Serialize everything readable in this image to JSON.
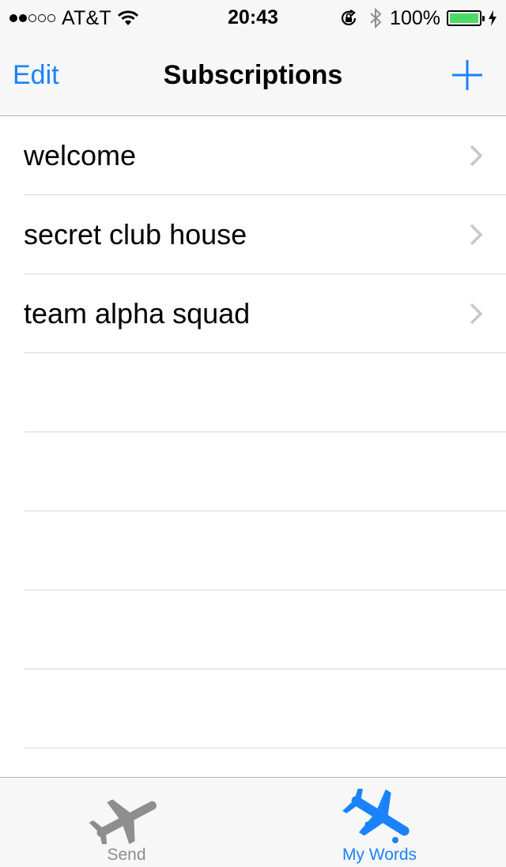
{
  "status_bar": {
    "carrier": "AT&T",
    "signal_bars_filled": 2,
    "signal_bars_total": 5,
    "time": "20:43",
    "battery_percent": "100%",
    "battery_color": "#4cd964",
    "icons": [
      "wifi-icon",
      "orientation-lock-icon",
      "bluetooth-icon",
      "battery-icon",
      "charging-bolt-icon"
    ]
  },
  "navbar": {
    "edit_label": "Edit",
    "title": "Subscriptions",
    "add_icon": "plus-icon"
  },
  "subscriptions": [
    {
      "label": "welcome"
    },
    {
      "label": "secret club house"
    },
    {
      "label": "team alpha squad"
    }
  ],
  "empty_rows": 5,
  "tabbar": {
    "tabs": [
      {
        "label": "Send",
        "icon": "airplane-takeoff-icon",
        "selected": false
      },
      {
        "label": "My Words",
        "icon": "airplane-landing-icon",
        "selected": true
      }
    ]
  },
  "colors": {
    "accent": "#1a82fb",
    "inactive": "#8e8e8e",
    "separator": "#d6d6d6"
  }
}
